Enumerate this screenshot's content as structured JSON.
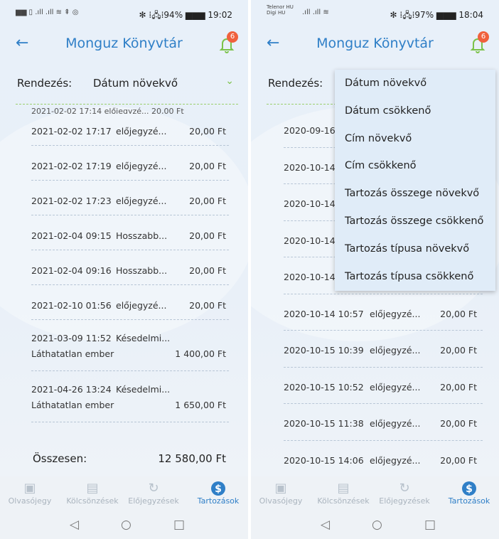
{
  "left": {
    "status": {
      "left": "▆▆ ▯ .ıll .ıll ≋ ⇞ ◎",
      "right": "✻ ⁞🖧⁞94% ▆▆▆ 19:02"
    },
    "header": {
      "title": "Monguz Könyvtár",
      "badge": "6"
    },
    "sort": {
      "label": "Rendezés:",
      "value": "Dátum növekvő"
    },
    "rows": [
      {
        "date": "2021-02-02 17:17",
        "type": "előjegyzé...",
        "amount": "20,00 Ft"
      },
      {
        "date": "2021-02-02 17:19",
        "type": "előjegyzé...",
        "amount": "20,00 Ft"
      },
      {
        "date": "2021-02-02 17:23",
        "type": "előjegyzé...",
        "amount": "20,00 Ft"
      },
      {
        "date": "2021-02-04 09:15",
        "type": "Hosszabb...",
        "amount": "20,00 Ft"
      },
      {
        "date": "2021-02-04 09:16",
        "type": "Hosszabb...",
        "amount": "20,00 Ft"
      },
      {
        "date": "2021-02-10 01:56",
        "type": "előjegyzé...",
        "amount": "20,00 Ft"
      }
    ],
    "tall_rows": [
      {
        "date": "2021-03-09 11:52",
        "type": "Késedelmi...",
        "name": "Láthatatlan ember",
        "amount": "1 400,00 Ft"
      },
      {
        "date": "2021-04-26 13:24",
        "type": "Késedelmi...",
        "name": "Láthatatlan ember",
        "amount": "1 650,00 Ft"
      }
    ],
    "total": {
      "label": "Összesen:",
      "amount": "12 580,00 Ft"
    }
  },
  "right": {
    "status": {
      "carrier1": "Telenor HU",
      "carrier2": "Digi HU",
      "signal": ".ıll .ıll ≋",
      "right": "✻ ⁞🖧⁞97% ▆▆▆ 18:04"
    },
    "header": {
      "title": "Monguz Könyvtár",
      "badge": "6"
    },
    "sort": {
      "label": "Rendezés:"
    },
    "partial_rows": [
      "2020-09-16",
      "2020-10-14",
      "2020-10-14",
      "2020-10-14",
      "2020-10-14"
    ],
    "rows": [
      {
        "date": "2020-10-14 10:57",
        "type": "előjegyzé...",
        "amount": "20,00 Ft"
      },
      {
        "date": "2020-10-15 10:39",
        "type": "előjegyzé...",
        "amount": "20,00 Ft"
      },
      {
        "date": "2020-10-15 10:52",
        "type": "előjegyzé...",
        "amount": "20,00 Ft"
      },
      {
        "date": "2020-10-15 11:38",
        "type": "előjegyzé...",
        "amount": "20,00 Ft"
      },
      {
        "date": "2020-10-15 14:06",
        "type": "előjegyzé...",
        "amount": "20,00 Ft"
      }
    ],
    "dropdown": [
      "Dátum növekvő",
      "Dátum csökkenő",
      "Cím növekvő",
      "Cím csökkenő",
      "Tartozás összege növekvő",
      "Tartozás összege csökkenő",
      "Tartozás típusa növekvő",
      "Tartozás típusa csökkenő"
    ]
  },
  "nav": {
    "items": [
      "Olvasójegy",
      "Kölcsönzések",
      "Előjegyzések",
      "Tartozások"
    ],
    "icons": [
      "card-icon",
      "book-icon",
      "reservation-icon",
      "dollar-icon"
    ],
    "active": "Tartozások"
  },
  "colors": {
    "accent": "#2f7fc7",
    "badge": "#f0613d",
    "chevron": "#7cc24a"
  }
}
